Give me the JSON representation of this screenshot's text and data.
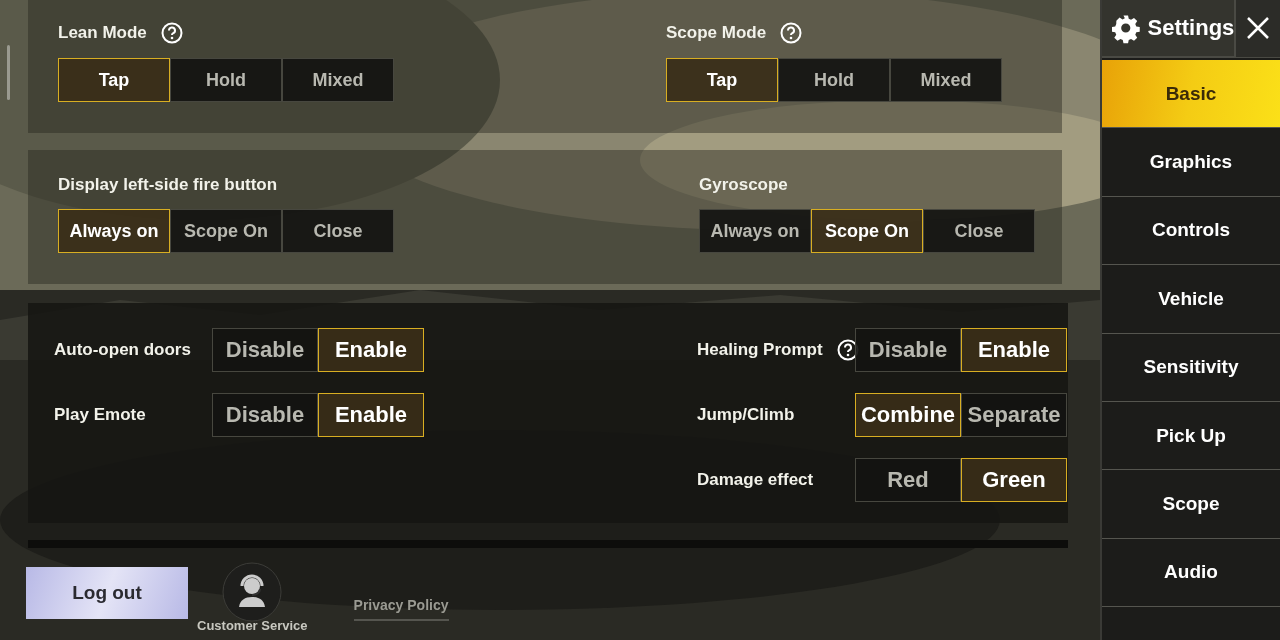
{
  "sections": [
    {
      "kind": "stacked",
      "columns": [
        [
          {
            "label": "Lean Mode",
            "help": true,
            "options": [
              {
                "label": "Tap",
                "selected": true
              },
              {
                "label": "Hold",
                "selected": false
              },
              {
                "label": "Mixed",
                "selected": false
              }
            ]
          }
        ],
        [
          {
            "label": "Scope Mode",
            "help": true,
            "options": [
              {
                "label": "Tap",
                "selected": true
              },
              {
                "label": "Hold",
                "selected": false
              },
              {
                "label": "Mixed",
                "selected": false
              }
            ]
          }
        ]
      ]
    },
    {
      "kind": "stacked",
      "columns": [
        [
          {
            "label": "Display left-side fire button",
            "help": false,
            "options": [
              {
                "label": "Always on",
                "selected": true
              },
              {
                "label": "Scope On",
                "selected": false
              },
              {
                "label": "Close",
                "selected": false
              }
            ]
          }
        ],
        [
          {
            "label": "Gyroscope",
            "help": false,
            "options": [
              {
                "label": "Always on",
                "selected": false
              },
              {
                "label": "Scope On",
                "selected": true
              },
              {
                "label": "Close",
                "selected": false
              }
            ]
          }
        ]
      ]
    },
    {
      "kind": "inline",
      "columns": [
        [
          {
            "label": "Auto-open doors",
            "help": false,
            "options": [
              {
                "label": "Disable",
                "selected": false
              },
              {
                "label": "Enable",
                "selected": true
              }
            ]
          },
          {
            "label": "Play Emote",
            "help": false,
            "options": [
              {
                "label": "Disable",
                "selected": false
              },
              {
                "label": "Enable",
                "selected": true
              }
            ]
          }
        ],
        [
          {
            "label": "Healing Prompt",
            "help": true,
            "options": [
              {
                "label": "Disable",
                "selected": false
              },
              {
                "label": "Enable",
                "selected": true
              }
            ]
          },
          {
            "label": "Jump/Climb",
            "help": false,
            "options": [
              {
                "label": "Combine",
                "selected": true
              },
              {
                "label": "Separate",
                "selected": false
              }
            ]
          },
          {
            "label": "Damage effect",
            "help": false,
            "options": [
              {
                "label": "Red",
                "selected": false
              },
              {
                "label": "Green",
                "selected": true
              }
            ]
          }
        ]
      ]
    }
  ],
  "footer": {
    "logout_button": "Log out",
    "customer_service": "Customer Service",
    "privacy_policy": "Privacy Policy"
  },
  "sidebar": {
    "title": "Settings",
    "items": [
      {
        "label": "Basic",
        "selected": true
      },
      {
        "label": "Graphics",
        "selected": false
      },
      {
        "label": "Controls",
        "selected": false
      },
      {
        "label": "Vehicle",
        "selected": false
      },
      {
        "label": "Sensitivity",
        "selected": false
      },
      {
        "label": "Pick Up",
        "selected": false
      },
      {
        "label": "Scope",
        "selected": false
      },
      {
        "label": "Audio",
        "selected": false
      }
    ]
  }
}
